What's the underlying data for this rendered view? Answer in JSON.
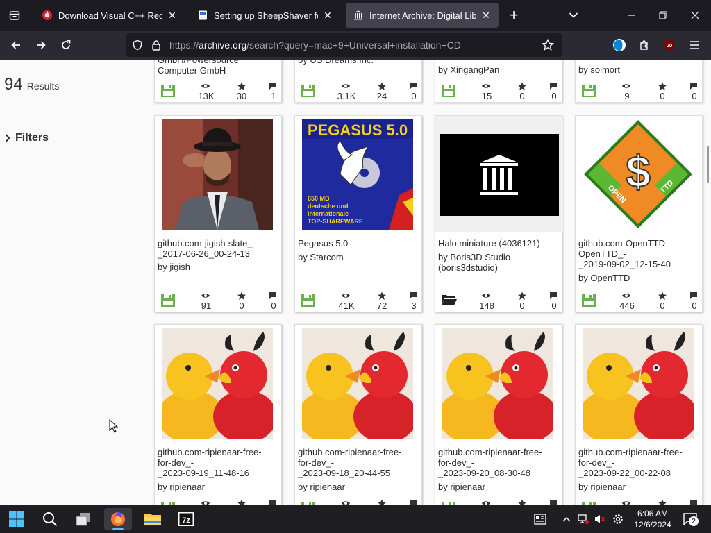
{
  "browser": {
    "tabs": [
      {
        "title": "Download Visual C++ Redistrib",
        "favicon": "opera-red-icon",
        "active": false
      },
      {
        "title": "Setting up SheepShaver for Win",
        "favicon": "page-icon",
        "active": false
      },
      {
        "title": "Internet Archive: Digital Library",
        "favicon": "archive-icon",
        "active": true
      }
    ],
    "url_prefix": "https://",
    "url_host": "archive.org",
    "url_path": "/search?query=mac+9+Universal+installation+CD",
    "accent_color": "#42414d"
  },
  "sidebar": {
    "results_count": "94",
    "results_label": "Results",
    "filters_label": "Filters"
  },
  "results": {
    "top_row": [
      {
        "title": "GmbH/Powersource\nComputer GmbH",
        "by": "",
        "media": "software",
        "views": "13K",
        "favs": "30",
        "reviews": "1"
      },
      {
        "title": "",
        "by": "by US Dreams Inc.",
        "media": "software",
        "views": "3.1K",
        "favs": "24",
        "reviews": "0"
      },
      {
        "title": "",
        "by": "by XingangPan",
        "media": "software",
        "views": "15",
        "favs": "0",
        "reviews": "0"
      },
      {
        "title": "",
        "by": "by soimort",
        "media": "software",
        "views": "9",
        "favs": "0",
        "reviews": "0"
      }
    ],
    "middle_row": [
      {
        "title": "github.com-jigish-slate_-\n_2017-06-26_00-24-13",
        "by": "by jigish",
        "media": "software",
        "thumb": "portrait-photo",
        "views": "91",
        "favs": "0",
        "reviews": "0"
      },
      {
        "title": "Pegasus 5.0",
        "by": "by Starcom",
        "media": "software",
        "thumb": "pegasus-cover",
        "cover_title": "PEGASUS 5.0",
        "cover_text": "650 MB\ndeutsche und\ninternationale\nTOP-SHAREWARE",
        "views": "41K",
        "favs": "72",
        "reviews": "3"
      },
      {
        "title": "Halo miniature (4036121)",
        "by": "by Boris3D Studio\n(boris3dstudio)",
        "media": "collection",
        "thumb": "archive-logo",
        "views": "148",
        "favs": "0",
        "reviews": "0"
      },
      {
        "title": "github.com-OpenTTD-\nOpenTTD_-\n_2019-09-02_12-15-40",
        "by": "by OpenTTD",
        "media": "software",
        "thumb": "openttd-logo",
        "logo_left": "OPEN",
        "logo_right": "TTD",
        "views": "446",
        "favs": "0",
        "reviews": "0"
      }
    ],
    "bottom_row": [
      {
        "title": "github.com-ripienaar-free-\nfor-dev_-\n_2023-09-19_11-48-16",
        "by": "by ripienaar",
        "thumb": "rubber-ducks"
      },
      {
        "title": "github.com-ripienaar-free-\nfor-dev_-\n_2023-09-18_20-44-55",
        "by": "by ripienaar",
        "thumb": "rubber-ducks"
      },
      {
        "title": "github.com-ripienaar-free-\nfor-dev_-\n_2023-09-20_08-30-48",
        "by": "by ripienaar",
        "thumb": "rubber-ducks"
      },
      {
        "title": "github.com-ripienaar-free-\nfor-dev_-\n_2023-09-22_00-22-08",
        "by": "by ripienaar",
        "thumb": "rubber-ducks"
      }
    ]
  },
  "taskbar": {
    "time": "6:06 AM",
    "date": "12/6/2024",
    "notification_count": "2",
    "apps": [
      "windows-start-icon",
      "search-icon",
      "task-view-icon",
      "firefox-icon",
      "file-explorer-icon",
      "7zip-icon"
    ]
  }
}
